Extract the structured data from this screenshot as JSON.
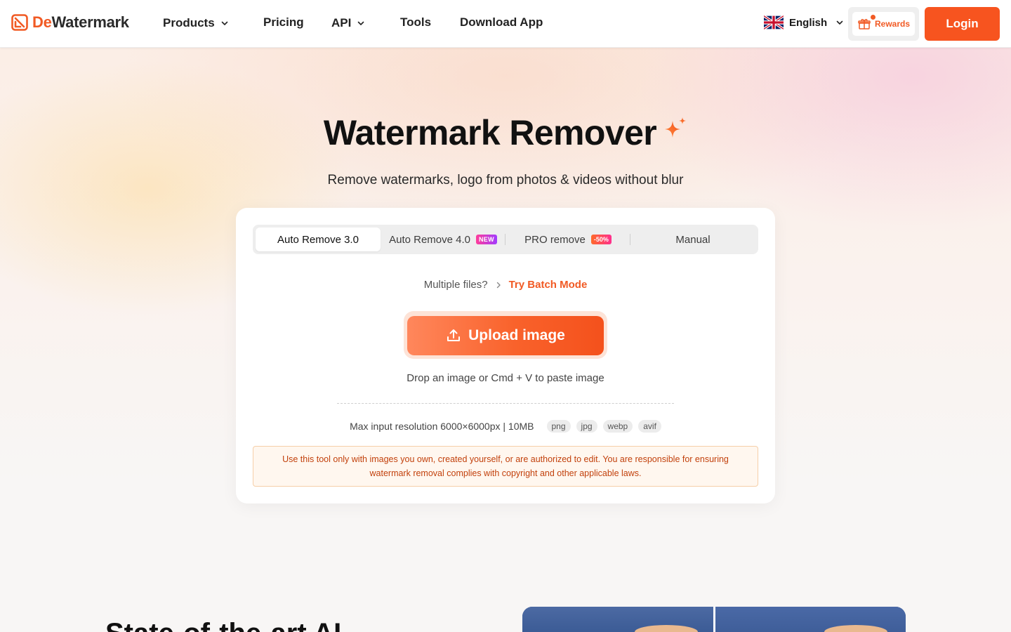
{
  "header": {
    "logo": {
      "brand_prefix": "De",
      "brand_suffix": "Watermark"
    },
    "nav": [
      {
        "label": "Products",
        "has_dropdown": true
      },
      {
        "label": "Pricing",
        "has_dropdown": false
      },
      {
        "label": "API",
        "has_dropdown": true
      },
      {
        "label": "Tools",
        "has_dropdown": false
      },
      {
        "label": "Download App",
        "has_dropdown": false
      }
    ],
    "language": {
      "label": "English",
      "flag_icon": "uk-flag-icon"
    },
    "rewards_label": "Rewards",
    "login_label": "Login"
  },
  "hero": {
    "title": "Watermark Remover",
    "subtitle": "Remove watermarks, logo from photos & videos without blur"
  },
  "tool": {
    "tabs": [
      {
        "label": "Auto Remove 3.0",
        "active": true,
        "badge": ""
      },
      {
        "label": "Auto Remove 4.0",
        "active": false,
        "badge": "NEW"
      },
      {
        "label": "PRO remove",
        "active": false,
        "badge": "-50%"
      },
      {
        "label": "Manual",
        "active": false,
        "badge": ""
      }
    ],
    "batch_prompt": "Multiple files?",
    "batch_link": "Try Batch Mode",
    "upload_label": "Upload image",
    "drop_hint": "Drop an image or Cmd + V to paste image",
    "limits_text": "Max input resolution 6000×6000px | 10MB",
    "formats": [
      "png",
      "jpg",
      "webp",
      "avif"
    ],
    "notice": "Use this tool only with images you own, created yourself, or are authorized to edit. You are responsible for ensuring watermark removal complies with copyright and other applicable laws."
  },
  "section": {
    "heading_partial": "State-of-the-art AI"
  },
  "colors": {
    "brand": "#f15a24",
    "login_bg": "#f7541f",
    "notice_text": "#c2410c",
    "notice_bg": "#fff7ef"
  }
}
